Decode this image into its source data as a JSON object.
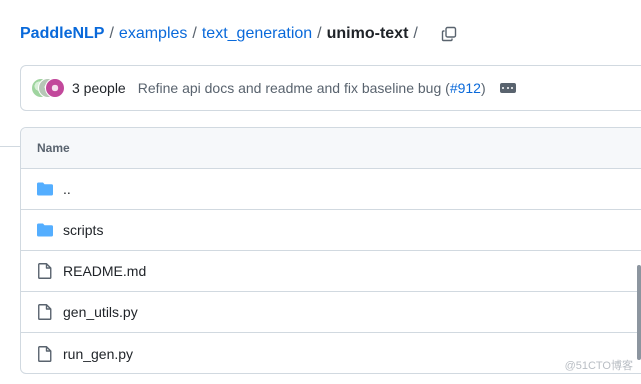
{
  "breadcrumb": {
    "root": "PaddleNLP",
    "sep": "/",
    "parts": [
      "examples",
      "text_generation"
    ],
    "current": "unimo-text",
    "trailing_sep": "/",
    "copy_icon": "copy-icon"
  },
  "commit": {
    "people": "3 people",
    "message": "Refine api docs and readme and fix baseline bug (",
    "pr": "#912",
    "message_end": ")",
    "more_icon": "ellipsis-icon"
  },
  "files": {
    "header": "Name",
    "rows": [
      {
        "name": "..",
        "icon": "folder-icon"
      },
      {
        "name": "scripts",
        "icon": "folder-icon"
      },
      {
        "name": "README.md",
        "icon": "file-icon"
      },
      {
        "name": "gen_utils.py",
        "icon": "file-icon"
      },
      {
        "name": "run_gen.py",
        "icon": "file-icon"
      }
    ]
  },
  "watermark": "@51CTO博客",
  "colors": {
    "link": "#0969da",
    "folder": "#54aeff",
    "border": "#d1d9e0",
    "muted": "#59636e"
  }
}
